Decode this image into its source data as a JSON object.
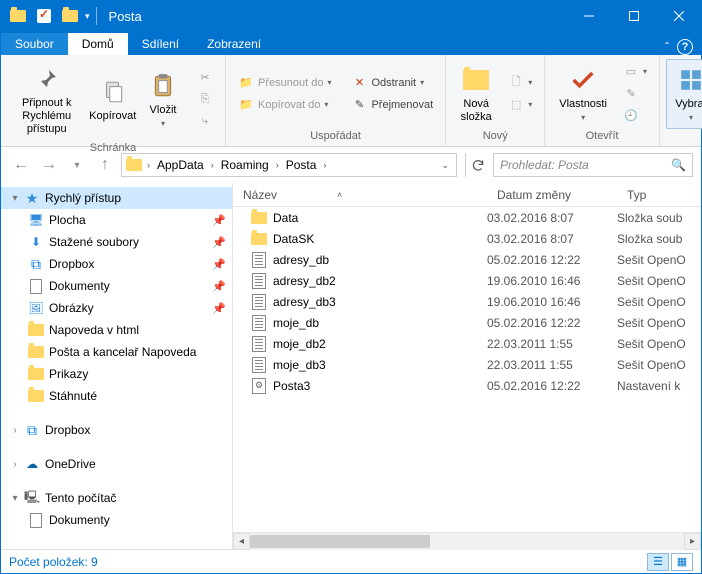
{
  "window": {
    "title": "Posta"
  },
  "tabs": {
    "file": "Soubor",
    "home": "Domů",
    "share": "Sdílení",
    "view": "Zobrazení"
  },
  "ribbon": {
    "pin": "Připnout k\nRychlému přístupu",
    "copy": "Kopírovat",
    "paste": "Vložit",
    "clipboard_group": "Schránka",
    "move_to": "Přesunout do",
    "copy_to": "Kopírovat do",
    "delete": "Odstranit",
    "rename": "Přejmenovat",
    "organize_group": "Uspořádat",
    "new_folder": "Nová\nsložka",
    "new_group": "Nový",
    "properties": "Vlastnosti",
    "open_group": "Otevřít",
    "select": "Vybrat"
  },
  "breadcrumb": {
    "seg1": "AppData",
    "seg2": "Roaming",
    "seg3": "Posta"
  },
  "search": {
    "placeholder": "Prohledat: Posta"
  },
  "tree": {
    "quick": "Rychlý přístup",
    "desktop": "Plocha",
    "downloads": "Stažené soubory",
    "dropbox": "Dropbox",
    "documents": "Dokumenty",
    "pictures": "Obrázky",
    "napoveda": "Napoveda v html",
    "posta_nap": "Pošta a kancelař Napoveda",
    "prikazy": "Prikazy",
    "stahnute": "Stáhnuté",
    "dropbox2": "Dropbox",
    "onedrive": "OneDrive",
    "thispc": "Tento počítač",
    "documents2": "Dokumenty"
  },
  "columns": {
    "name": "Název",
    "date": "Datum změny",
    "type": "Typ"
  },
  "files": [
    {
      "icon": "folder",
      "name": "Data",
      "date": "03.02.2016 8:07",
      "type": "Složka soub"
    },
    {
      "icon": "folder",
      "name": "DataSK",
      "date": "03.02.2016 8:07",
      "type": "Složka soub"
    },
    {
      "icon": "grid",
      "name": "adresy_db",
      "date": "05.02.2016 12:22",
      "type": "Sešit OpenO"
    },
    {
      "icon": "grid",
      "name": "adresy_db2",
      "date": "19.06.2010 16:46",
      "type": "Sešit OpenO"
    },
    {
      "icon": "grid",
      "name": "adresy_db3",
      "date": "19.06.2010 16:46",
      "type": "Sešit OpenO"
    },
    {
      "icon": "grid",
      "name": "moje_db",
      "date": "05.02.2016 12:22",
      "type": "Sešit OpenO"
    },
    {
      "icon": "grid",
      "name": "moje_db2",
      "date": "22.03.2011 1:55",
      "type": "Sešit OpenO"
    },
    {
      "icon": "grid",
      "name": "moje_db3",
      "date": "22.03.2011 1:55",
      "type": "Sešit OpenO"
    },
    {
      "icon": "gear",
      "name": "Posta3",
      "date": "05.02.2016 12:22",
      "type": "Nastavení k"
    }
  ],
  "status": {
    "count_label": "Počet položek: 9"
  }
}
